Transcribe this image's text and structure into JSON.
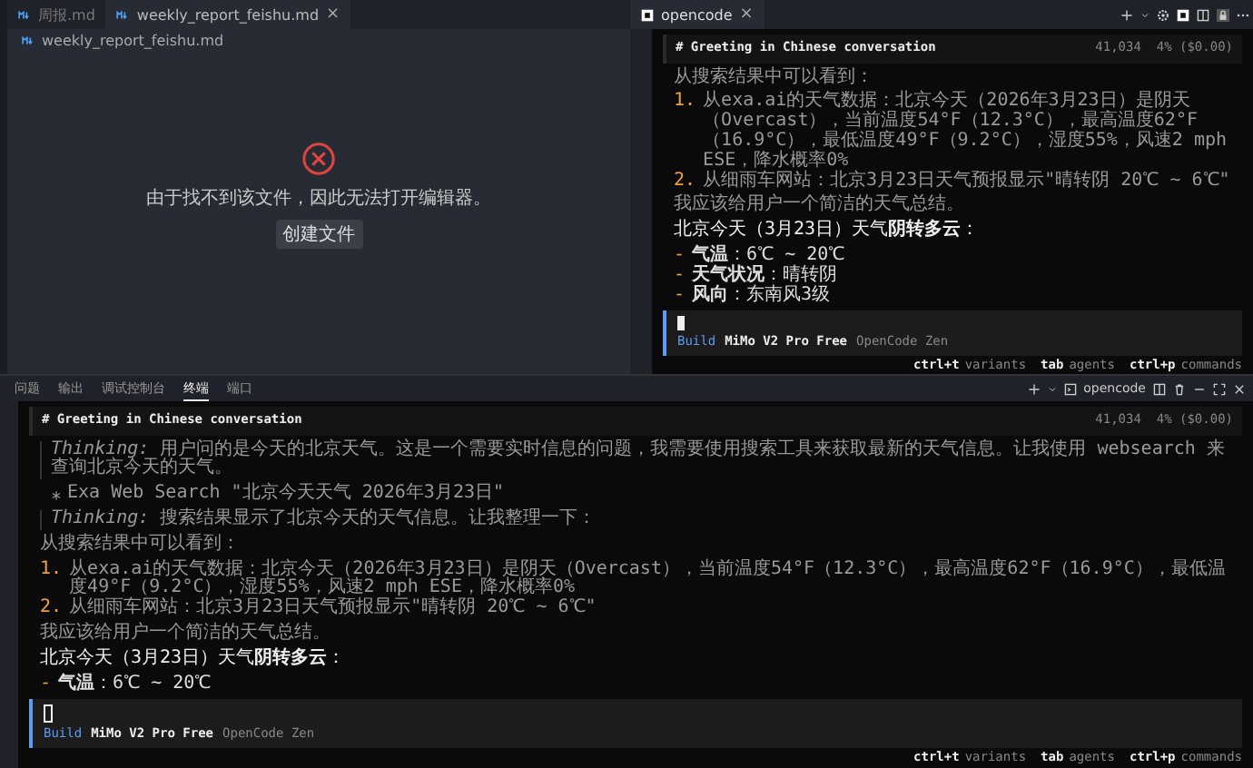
{
  "editor": {
    "tabs": [
      {
        "label": "周报.md",
        "selected": false
      },
      {
        "label": "weekly_report_feishu.md",
        "selected": true,
        "close": "×"
      }
    ],
    "breadcrumb": "weekly_report_feishu.md",
    "error": {
      "message": "由于找不到该文件，因此无法打开编辑器。",
      "button": "创建文件"
    }
  },
  "side_terminal": {
    "tab": {
      "label": "opencode",
      "close": "×"
    },
    "session": {
      "title": "# Greeting in Chinese conversation",
      "stats": "41,034  4% ($0.00)",
      "blocks": [
        {
          "kind": "plain",
          "text": "从搜索结果中可以看到："
        },
        {
          "kind": "numbered",
          "items": [
            {
              "marker": "1.",
              "text": "从exa.ai的天气数据：北京今天（2026年3月23日）是阴天（Overcast），当前温度54°F（12.3°C），最高温度62°F（16.9°C），最低温度49°F（9.2°C），湿度55%，风速2 mph ESE，降水概率0%"
            },
            {
              "marker": "2.",
              "text": "从细雨车网站：北京3月23日天气预报显示\"晴转阴 20℃ ~ 6℃\""
            }
          ]
        },
        {
          "kind": "plain",
          "text": "我应该给用户一个简洁的天气总结。"
        },
        {
          "kind": "heading",
          "text": "北京今天（3月23日）天气**阴转多云**："
        },
        {
          "kind": "bullets",
          "items": [
            {
              "marker": "-",
              "text": "**气温**：6℃ ~ 20℃"
            },
            {
              "marker": "-",
              "text": "**天气状况**：晴转阴"
            },
            {
              "marker": "-",
              "text": "**风向**：东南风3级"
            }
          ]
        }
      ],
      "agent": "Build",
      "model": "MiMo V2 Pro Free",
      "provider": "OpenCode Zen",
      "hints": [
        {
          "key": "ctrl+t",
          "label": "variants"
        },
        {
          "key": "tab",
          "label": "agents"
        },
        {
          "key": "ctrl+p",
          "label": "commands"
        }
      ]
    }
  },
  "panel": {
    "tabs": [
      {
        "label": "问题",
        "selected": false
      },
      {
        "label": "输出",
        "selected": false
      },
      {
        "label": "调试控制台",
        "selected": false
      },
      {
        "label": "终端",
        "selected": true
      },
      {
        "label": "端口",
        "selected": false
      }
    ],
    "terminal_label": "opencode",
    "session": {
      "title": "# Greeting in Chinese conversation",
      "stats": "41,034  4% ($0.00)",
      "blocks": [
        {
          "kind": "thinking",
          "text": "*Thinking:* 用户问的是今天的北京天气。这是一个需要实时信息的问题，我需要使用搜索工具来获取最新的天气信息。让我使用 websearch 来查询北京今天的天气。"
        },
        {
          "kind": "tool",
          "text": "Exa Web Search \"北京今天天气 2026年3月23日\""
        },
        {
          "kind": "thinking",
          "text": "*Thinking:* 搜索结果显示了北京今天的天气信息。让我整理一下："
        },
        {
          "kind": "plain",
          "text": "从搜索结果中可以看到："
        },
        {
          "kind": "numbered",
          "items": [
            {
              "marker": "1.",
              "text": "从exa.ai的天气数据：北京今天（2026年3月23日）是阴天（Overcast），当前温度54°F（12.3°C），最高温度62°F（16.9°C），最低温度49°F（9.2°C），湿度55%，风速2 mph ESE，降水概率0%"
            },
            {
              "marker": "2.",
              "text": "从细雨车网站：北京3月23日天气预报显示\"晴转阴 20℃ ~ 6℃\""
            }
          ]
        },
        {
          "kind": "plain",
          "text": "我应该给用户一个简洁的天气总结。"
        },
        {
          "kind": "heading",
          "text": "北京今天（3月23日）天气**阴转多云**："
        },
        {
          "kind": "bullets",
          "items": [
            {
              "marker": "-",
              "text": "**气温**：6℃ ~ 20℃"
            }
          ]
        }
      ],
      "agent": "Build",
      "model": "MiMo V2 Pro Free",
      "provider": "OpenCode Zen",
      "hints": [
        {
          "key": "ctrl+t",
          "label": "variants"
        },
        {
          "key": "tab",
          "label": "agents"
        },
        {
          "key": "ctrl+p",
          "label": "commands"
        }
      ]
    }
  }
}
